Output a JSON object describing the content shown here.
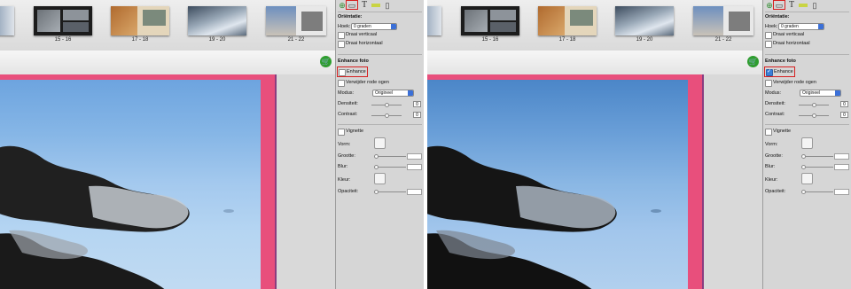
{
  "thumbnails": [
    {
      "label": "15 - 16",
      "colors": [
        "#222222",
        "#8a8f96"
      ]
    },
    {
      "label": "17 - 18",
      "colors": [
        "#c48a4a",
        "#d8c7a2"
      ]
    },
    {
      "label": "19 - 20",
      "colors": [
        "#6c7d92",
        "#c9d3de"
      ]
    },
    {
      "label": "21 - 22",
      "colors": [
        "#5f85b8",
        "#e3e3e3"
      ]
    }
  ],
  "panel": {
    "orientation_label": "Oriëntatie:",
    "angle_label": "Hoek:",
    "angle_value": "0 graden",
    "flip_vertical": "Draai verticaal",
    "flip_horizontal": "Draai horizontaal",
    "enhance_section": "Enhance foto",
    "enhance_label": "Enhance",
    "redeye_label": "Verwijder rode ogen",
    "mode_label": "Modus:",
    "mode_value": "Origineel",
    "density_label": "Densiteit:",
    "density_value": "0",
    "contrast_label": "Contrast:",
    "contrast_value": "0",
    "vignette_label": "Vignette",
    "shape_label": "Vorm:",
    "size_label": "Grootte:",
    "blur_label": "Blur:",
    "color_label": "Kleur:",
    "opacity_label": "Opaciteit:"
  },
  "states": {
    "left": {
      "enhance_checked": false
    },
    "right": {
      "enhance_checked": true
    }
  },
  "colors": {
    "highlight": "#d62020",
    "photo_border": "#e84f7c",
    "cart": "#2e9e2e"
  },
  "icons": [
    "add-photo-icon",
    "frame-icon",
    "text-icon",
    "color-bar-icon",
    "page-icon",
    "cart-icon"
  ]
}
